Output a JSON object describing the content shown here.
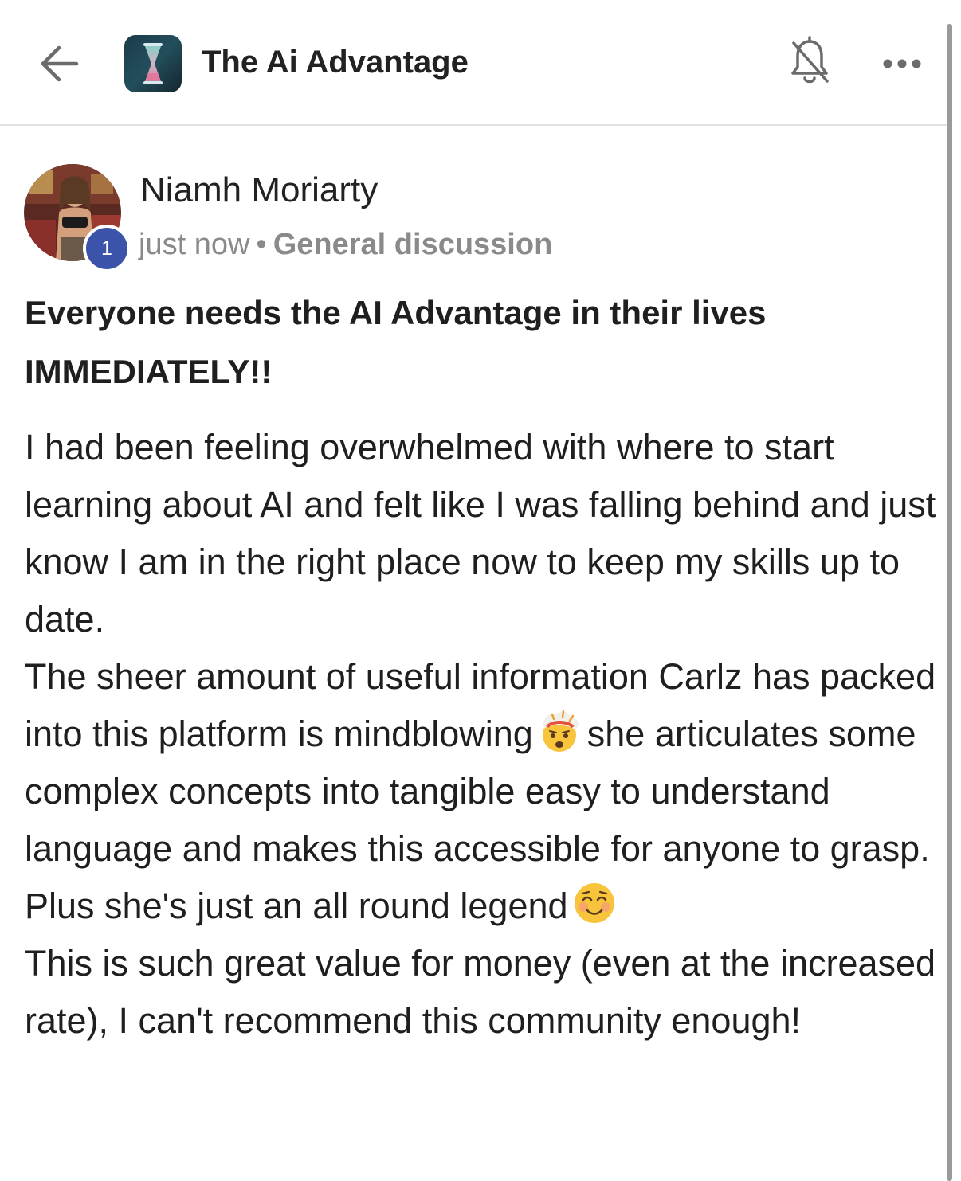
{
  "header": {
    "title": "The Ai Advantage",
    "back_icon": "arrow-left-icon",
    "logo_icon": "hourglass-logo",
    "notification_icon": "bell-muted-icon",
    "more_icon": "ellipsis-icon"
  },
  "post": {
    "author": {
      "name": "Niamh Moriarty",
      "level": "1",
      "avatar_icon": "user-avatar-photo"
    },
    "timestamp": "just now",
    "separator": "•",
    "category": "General discussion",
    "title": "Everyone needs the AI Advantage in their lives IMMEDIATELY!!",
    "body": {
      "p1": "I had been feeling overwhelmed with where to start learning about AI and felt like I was falling behind and just know I am in the right place now to keep my skills up to date.",
      "p2_before_emoji": "The sheer amount of useful information Carlz has packed into this platform is mindblowing",
      "p2_after_emoji": "she articulates some complex concepts into tangible easy to understand language and makes this accessible for anyone to grasp. Plus she's just an all round legend",
      "p3": "This is such great value for money (even at the increased rate), I can't recommend this community enough!"
    },
    "emojis": [
      "exploding-head-emoji",
      "smiling-face-emoji"
    ]
  },
  "colors": {
    "badge": "#3b53a8",
    "meta_text": "#8a8a8a",
    "divider": "#e3e3e3"
  }
}
